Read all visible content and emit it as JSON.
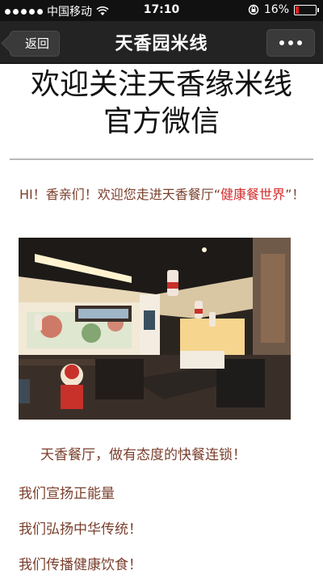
{
  "status": {
    "carrier": "中国移动",
    "time": "17:10",
    "battery": "16%",
    "battery_level": 0.16
  },
  "nav": {
    "back": "返回",
    "title": "天香园米线"
  },
  "article": {
    "headline": [
      "欢迎关注天香缘米线",
      "官方微信"
    ],
    "greeting_prefix": "HI！香亲们！欢迎您走进天香餐厅“",
    "greeting_highlight": "健康餐世界",
    "greeting_suffix": "”！",
    "paragraphs": [
      "天香餐厅，做有态度的快餐连锁！",
      "我们宣扬正能量",
      "我们弘扬中华传统！",
      "我们传播健康饮食！"
    ]
  },
  "colors": {
    "text": "#7a3f2c",
    "highlight": "#d22b2b",
    "navbar": "#232323"
  }
}
